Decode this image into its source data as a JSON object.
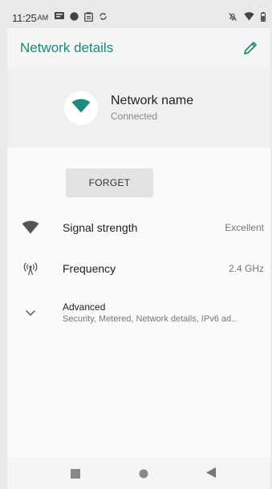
{
  "statusbar": {
    "time": "11:25",
    "ampm": "AM",
    "icons": [
      "message-icon",
      "circle-icon",
      "clipboard-icon",
      "sync-icon",
      "mute-icon",
      "wifi-icon",
      "battery-icon"
    ]
  },
  "appbar": {
    "title": "Network details",
    "edit_icon": "pencil-icon"
  },
  "network": {
    "name": "Network name",
    "status": "Connected"
  },
  "actions": {
    "forget_label": "FORGET"
  },
  "details": {
    "signal": {
      "label": "Signal strength",
      "value": "Excellent"
    },
    "frequency": {
      "label": "Frequency",
      "value": "2.4 GHz"
    },
    "advanced": {
      "title": "Advanced",
      "subtitle": "Security, Metered, Network details, IPv6 ad.."
    }
  },
  "colors": {
    "accent": "#1c8a7c",
    "icon": "#555555"
  },
  "navbar": {
    "buttons": [
      "recents-button",
      "home-button",
      "back-button"
    ]
  }
}
